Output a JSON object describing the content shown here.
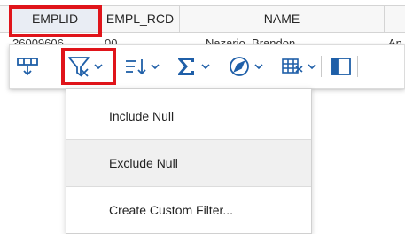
{
  "grid": {
    "columns": [
      "EMPLID",
      "EMPL_RCD",
      "NAME"
    ],
    "first_row": [
      "26009606",
      "00",
      "Nazario, Brandon",
      "An"
    ]
  },
  "toolbar": {
    "items": [
      {
        "icon": "insert-row-icon",
        "has_menu": false
      },
      {
        "icon": "filter-icon",
        "has_menu": true,
        "active": true
      },
      {
        "icon": "sort-icon",
        "has_menu": true
      },
      {
        "icon": "sigma-icon",
        "has_menu": true
      },
      {
        "icon": "compass-icon",
        "has_menu": true
      },
      {
        "icon": "table-settings-icon",
        "has_menu": true
      },
      {
        "icon": "panel-icon",
        "has_menu": false
      }
    ]
  },
  "filter_menu": {
    "items": [
      "Include Null",
      "Exclude Null",
      "Create Custom Filter..."
    ],
    "hovered": "Exclude Null"
  },
  "colors": {
    "highlight": "#e0141a",
    "icon": "#1f5fa8"
  }
}
